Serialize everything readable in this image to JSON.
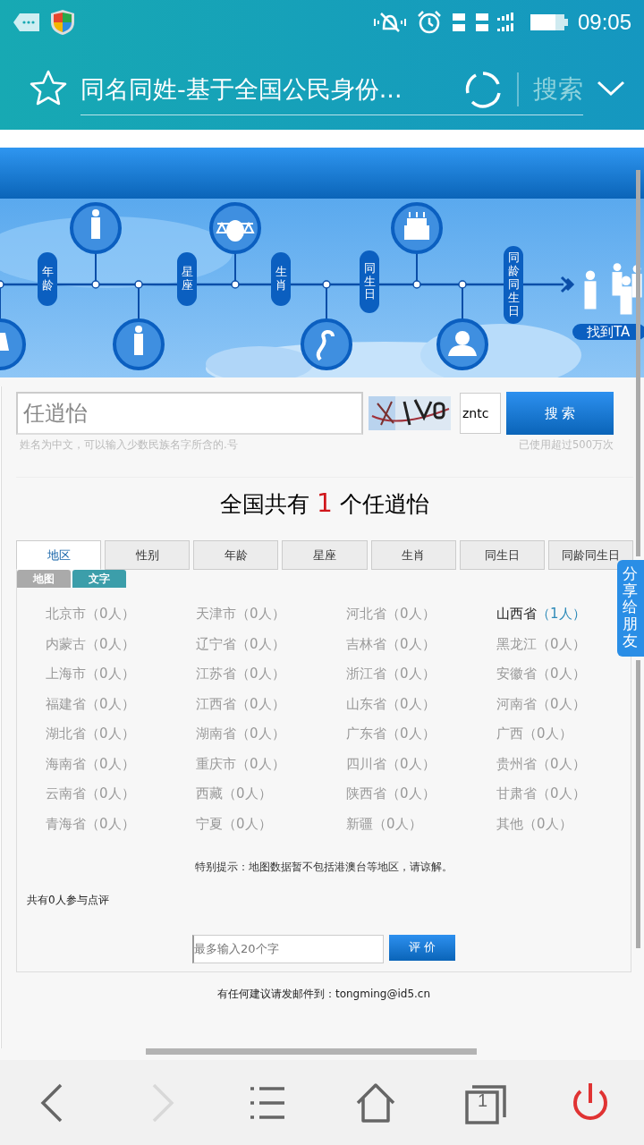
{
  "status_bar": {
    "time": "09:05"
  },
  "browser_bar": {
    "title": "同名同姓-基于全国公民身份...",
    "search_label": "搜索"
  },
  "banner": {
    "labels": [
      {
        "text": "年龄"
      },
      {
        "text": "星座"
      },
      {
        "text": "生肖"
      },
      {
        "text": "同生日"
      },
      {
        "text": "同龄同生日"
      }
    ],
    "cta": "找到TA"
  },
  "search": {
    "name_value": "任逍怡",
    "captcha_value": "zntc",
    "button": "搜 索",
    "hint": "姓名为中文，可以输入少数民族名字所含的.号",
    "usage": "已使用超过500万次"
  },
  "result": "全国共有 **1** 个任逍怡",
  "tabs": [
    {
      "label": "地区",
      "selected": true
    },
    {
      "label": "性别",
      "selected": false
    },
    {
      "label": "年龄",
      "selected": false
    },
    {
      "label": "星座",
      "selected": false
    },
    {
      "label": "生肖",
      "selected": false
    },
    {
      "label": "同生日",
      "selected": false
    },
    {
      "label": "同龄同生日",
      "selected": false
    }
  ],
  "view_tabs": [
    {
      "label": "地图",
      "selected": false
    },
    {
      "label": "文字",
      "selected": true
    }
  ],
  "regions": [
    {
      "name": "北京市",
      "count": "（0人）",
      "highlighted": false
    },
    {
      "name": "天津市",
      "count": "（0人）",
      "highlighted": false
    },
    {
      "name": "河北省",
      "count": "（0人）",
      "highlighted": false
    },
    {
      "name": "山西省",
      "count": "（1人）",
      "highlighted": true
    },
    {
      "name": "内蒙古",
      "count": "（0人）",
      "highlighted": false
    },
    {
      "name": "辽宁省",
      "count": "（0人）",
      "highlighted": false
    },
    {
      "name": "吉林省",
      "count": "（0人）",
      "highlighted": false
    },
    {
      "name": "黑龙江",
      "count": "（0人）",
      "highlighted": false
    },
    {
      "name": "上海市",
      "count": "（0人）",
      "highlighted": false
    },
    {
      "name": "江苏省",
      "count": "（0人）",
      "highlighted": false
    },
    {
      "name": "浙江省",
      "count": "（0人）",
      "highlighted": false
    },
    {
      "name": "安徽省",
      "count": "（0人）",
      "highlighted": false
    },
    {
      "name": "福建省",
      "count": "（0人）",
      "highlighted": false
    },
    {
      "name": "江西省",
      "count": "（0人）",
      "highlighted": false
    },
    {
      "name": "山东省",
      "count": "（0人）",
      "highlighted": false
    },
    {
      "name": "河南省",
      "count": "（0人）",
      "highlighted": false
    },
    {
      "name": "湖北省",
      "count": "（0人）",
      "highlighted": false
    },
    {
      "name": "湖南省",
      "count": "（0人）",
      "highlighted": false
    },
    {
      "name": "广东省",
      "count": "（0人）",
      "highlighted": false
    },
    {
      "name": "广西",
      "count": "（0人）",
      "highlighted": false
    },
    {
      "name": "海南省",
      "count": "（0人）",
      "highlighted": false
    },
    {
      "name": "重庆市",
      "count": "（0人）",
      "highlighted": false
    },
    {
      "name": "四川省",
      "count": "（0人）",
      "highlighted": false
    },
    {
      "name": "贵州省",
      "count": "（0人）",
      "highlighted": false
    },
    {
      "name": "云南省",
      "count": "（0人）",
      "highlighted": false
    },
    {
      "name": "西藏",
      "count": "（0人）",
      "highlighted": false
    },
    {
      "name": "陕西省",
      "count": "（0人）",
      "highlighted": false
    },
    {
      "name": "甘肃省",
      "count": "（0人）",
      "highlighted": false
    },
    {
      "name": "青海省",
      "count": "（0人）",
      "highlighted": false
    },
    {
      "name": "宁夏",
      "count": "（0人）",
      "highlighted": false
    },
    {
      "name": "新疆",
      "count": "（0人）",
      "highlighted": false
    },
    {
      "name": "其他",
      "count": "（0人）",
      "highlighted": false
    }
  ],
  "notice": "特别提示：地图数据暂不包括港澳台等地区，请谅解。",
  "review_count": "共有0人参与点评",
  "review": {
    "placeholder": "最多输入20个字",
    "button": "评 价"
  },
  "contact": "有任何建议请发邮件到：tongming@id5.cn",
  "share_tab": "分享给朋友",
  "nav": [
    {
      "kind": "back",
      "disabled": false
    },
    {
      "kind": "forward",
      "disabled": true
    },
    {
      "kind": "menu",
      "disabled": false
    },
    {
      "kind": "home",
      "disabled": false
    },
    {
      "kind": "tabs",
      "disabled": false,
      "count": "1"
    },
    {
      "kind": "power",
      "disabled": false
    }
  ]
}
